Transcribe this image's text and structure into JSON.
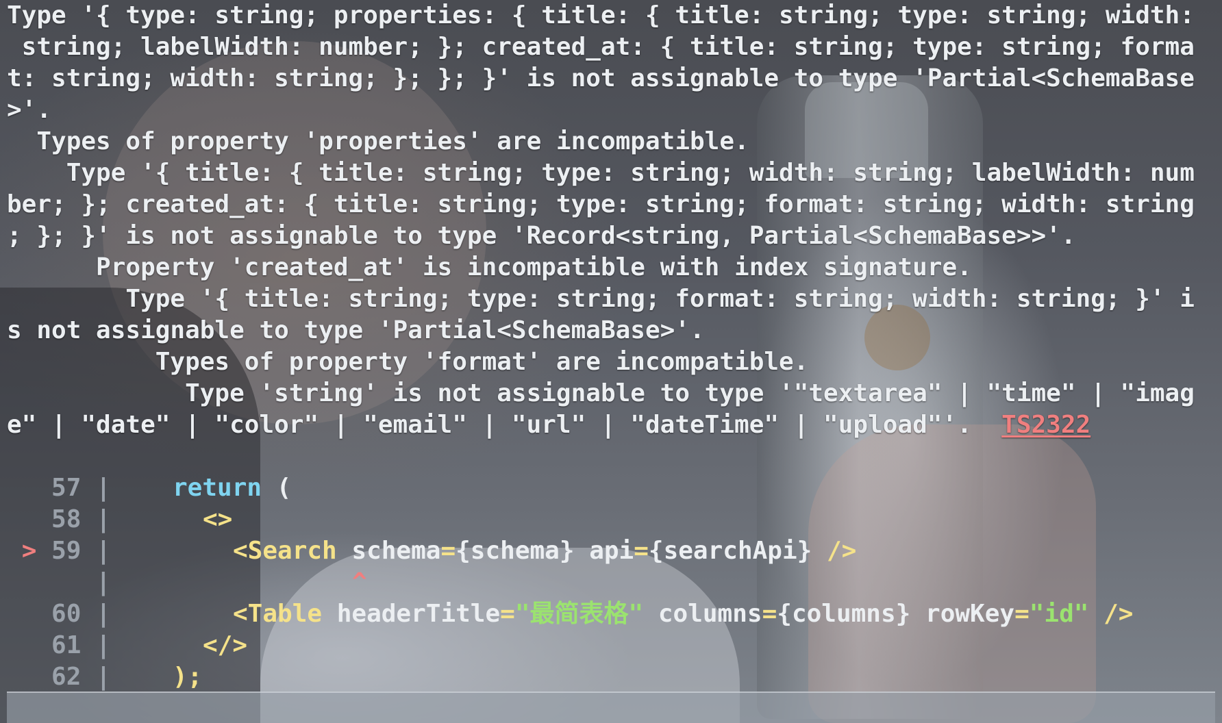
{
  "error": {
    "lines": [
      "Type '{ type: string; properties: { title: { title: string; type: string; width:",
      " string; labelWidth: number; }; created_at: { title: string; type: string; forma",
      "t: string; width: string; }; }; }' is not assignable to type 'Partial<SchemaBase",
      ">'.",
      "  Types of property 'properties' are incompatible.",
      "    Type '{ title: { title: string; type: string; width: string; labelWidth: num",
      "ber; }; created_at: { title: string; type: string; format: string; width: string",
      "; }; }' is not assignable to type 'Record<string, Partial<SchemaBase>>'.",
      "      Property 'created_at' is incompatible with index signature.",
      "        Type '{ title: string; type: string; format: string; width: string; }' i",
      "s not assignable to type 'Partial<SchemaBase>'.",
      "          Types of property 'format' are incompatible.",
      "            Type 'string' is not assignable to type '\"textarea\" | \"time\" | \"imag"
    ],
    "last_line": "e\" | \"date\" | \"color\" | \"email\" | \"url\" | \"dateTime\" | \"upload\"'.  ",
    "code": "TS2322"
  },
  "code": {
    "line57": {
      "num": "57",
      "kw": "return",
      "rest": " ("
    },
    "line58": {
      "num": "58",
      "tag": "<>"
    },
    "line59": {
      "marker": ">",
      "num": "59",
      "tag": "<Search",
      "attr1": " schema",
      "eq1": "=",
      "val1": "{schema}",
      "attr2": " api",
      "eq2": "=",
      "val2": "{searchApi}",
      "close": " />"
    },
    "caret": "^",
    "line60": {
      "num": "60",
      "tag": "<Table",
      "attr1": " headerTitle",
      "eq1": "=",
      "str1": "\"最简表格\"",
      "attr2": " columns",
      "eq2": "=",
      "val2": "{columns}",
      "attr3": " rowKey",
      "eq3": "=",
      "str3": "\"id\"",
      "close": " />"
    },
    "line61": {
      "num": "61",
      "tag": "</>"
    },
    "line62": {
      "num": "62",
      "rest": ");"
    }
  },
  "colors": {
    "error_text": "#eceff2",
    "error_code": "#f07f7f",
    "keyword": "#7fd4f0",
    "jsx_tag": "#f5e28a",
    "string": "#9be36f",
    "gutter": "#9aa1aa"
  }
}
